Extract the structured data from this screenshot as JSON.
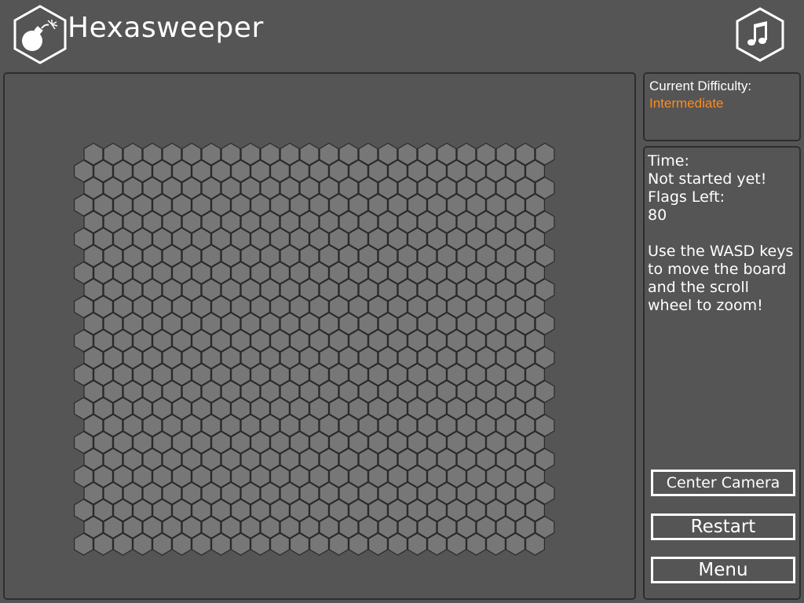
{
  "header": {
    "title": "Hexasweeper",
    "logo_icon": "bomb-icon",
    "music_icon": "music-note-icon"
  },
  "difficulty": {
    "label": "Current Difficulty:",
    "value": "Intermediate",
    "value_color": "#ff8c1a"
  },
  "status": {
    "time_label": "Time:",
    "time_value": "Not started yet!",
    "flags_label": "Flags Left:",
    "flags_value": "80",
    "hint": "Use the WASD keys to move the board and the scroll wheel to zoom!"
  },
  "buttons": {
    "center_camera": "Center Camera",
    "restart": "Restart",
    "menu": "Menu"
  },
  "board": {
    "rows": 24,
    "cols": 24,
    "cell_state": "unrevealed",
    "cell_color": "#777777",
    "cell_border_color": "#2a2a2a"
  }
}
